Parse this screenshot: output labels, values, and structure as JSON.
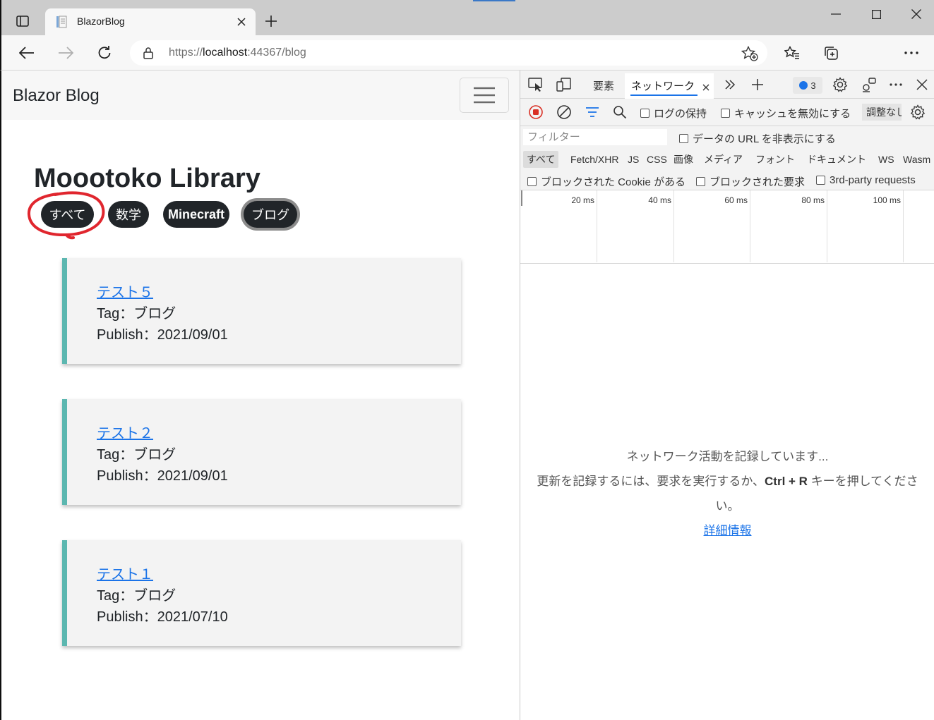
{
  "browser": {
    "tab_title": "BlazorBlog",
    "url_scheme": "https://",
    "url_host": "localhost",
    "url_rest": ":44367/blog"
  },
  "page": {
    "brand": "Blazor Blog",
    "title": "Moootoko Library",
    "filters": [
      "すべて",
      "数学",
      "Minecraft",
      "ブログ"
    ],
    "posts": [
      {
        "title": "テスト５",
        "tag": "Tag：ブログ",
        "publish": "Publish：2021/09/01"
      },
      {
        "title": "テスト２",
        "tag": "Tag：ブログ",
        "publish": "Publish：2021/09/01"
      },
      {
        "title": "テスト１",
        "tag": "Tag：ブログ",
        "publish": "Publish：2021/07/10"
      }
    ]
  },
  "devtools": {
    "tabs": {
      "elements": "要素",
      "network": "ネットワーク"
    },
    "issues_count": "3",
    "preserve_log": "ログの保持",
    "disable_cache": "キャッシュを無効にする",
    "throttling": "調整なし",
    "filter_placeholder": "フィルター",
    "hide_data_urls": "データの URL を非表示にする",
    "types": [
      "すべて",
      "Fetch/XHR",
      "JS",
      "CSS",
      "画像",
      "メディア",
      "フォント",
      "ドキュメント",
      "WS",
      "Wasm"
    ],
    "blocked_cookies": "ブロックされた Cookie がある",
    "blocked_requests": "ブロックされた要求",
    "third_party": "3rd-party requests",
    "timeline_labels": [
      "20 ms",
      "40 ms",
      "60 ms",
      "80 ms",
      "100 ms"
    ],
    "empty": {
      "line1": "ネットワーク活動を記録しています...",
      "line2_a": "更新を記録するには、要求を実行するか、",
      "line2_key": "Ctrl + R",
      "line2_b": " キーを押してください。",
      "link": "詳細情報"
    }
  },
  "colors": {
    "accent": "#1a73e8",
    "card_border": "#5cb7b0",
    "pill_bg": "#212529",
    "annotation_red": "#e0262e"
  }
}
